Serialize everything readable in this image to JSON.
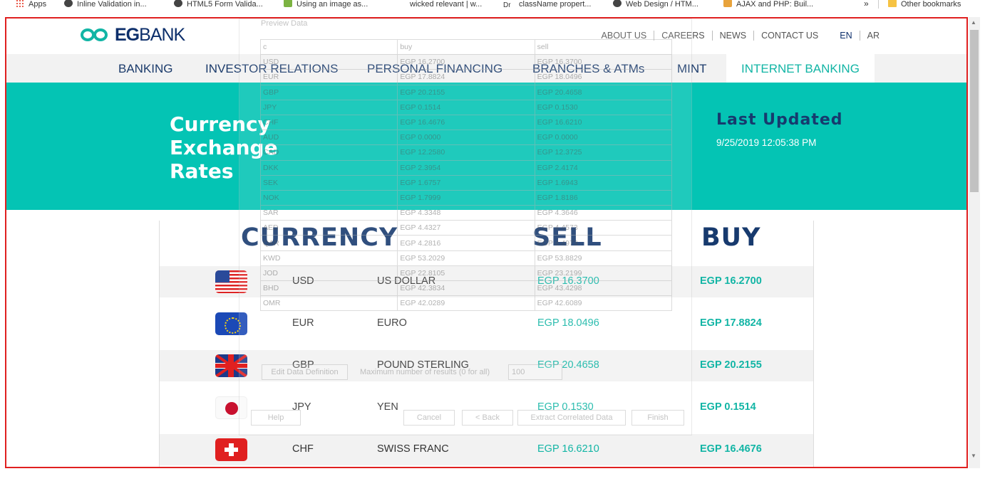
{
  "bookmarks": [
    {
      "label": "Apps",
      "icon": "apps-grid-icon"
    },
    {
      "label": "Inline Validation in...",
      "icon": "site-icon"
    },
    {
      "label": "HTML5 Form Valida...",
      "icon": "linux-icon"
    },
    {
      "label": "Using an image as...",
      "icon": "site-icon"
    },
    {
      "label": "wicked relevant | w...",
      "icon": "site-icon"
    },
    {
      "label": "className propert...",
      "icon": "dr-icon"
    },
    {
      "label": "Web Design / HTM...",
      "icon": "globe-icon"
    },
    {
      "label": "AJAX and PHP: Buil...",
      "icon": "book-icon"
    }
  ],
  "bookmarks_more": "»",
  "bookmarks_other": "Other bookmarks",
  "header": {
    "logo_text_bold": "EG",
    "logo_text": "BANK",
    "top_links": [
      "ABOUT US",
      "CAREERS",
      "NEWS",
      "CONTACT US"
    ],
    "lang": [
      "EN",
      "AR"
    ]
  },
  "nav": [
    "BANKING",
    "INVESTOR RELATIONS",
    "PERSONAL FINANCING",
    "BRANCHES & ATMs",
    "MINT",
    "INTERNET BANKING"
  ],
  "banner": {
    "title": "Currency\nExchange\nRates",
    "updated_label": "Last Updated",
    "updated_value": "9/25/2019 12:05:38 PM"
  },
  "rates": {
    "headers": {
      "currency": "CURRENCY",
      "sell": "SELL",
      "buy": "BUY"
    },
    "rows": [
      {
        "code": "USD",
        "name": "US DOLLAR",
        "sell": "EGP 16.3700",
        "buy": "EGP 16.2700",
        "flag": "us-flag-icon"
      },
      {
        "code": "EUR",
        "name": "EURO",
        "sell": "EGP 18.0496",
        "buy": "EGP 17.8824",
        "flag": "eu-flag-icon"
      },
      {
        "code": "GBP",
        "name": "POUND STERLING",
        "sell": "EGP 20.4658",
        "buy": "EGP 20.2155",
        "flag": "uk-flag-icon"
      },
      {
        "code": "JPY",
        "name": "YEN",
        "sell": "EGP 0.1530",
        "buy": "EGP 0.1514",
        "flag": "japan-flag-icon"
      },
      {
        "code": "CHF",
        "name": "SWISS FRANC",
        "sell": "EGP 16.6210",
        "buy": "EGP 16.4676",
        "flag": "swiss-flag-icon"
      }
    ]
  },
  "overlay": {
    "title": "Preview Data",
    "columns": [
      "c",
      "buy",
      "sell"
    ],
    "rows": [
      [
        "USD",
        "EGP 16.2700",
        "EGP 16.3700"
      ],
      [
        "EUR",
        "EGP 17.8824",
        "EGP 18.0496"
      ],
      [
        "GBP",
        "EGP 20.2155",
        "EGP 20.4658"
      ],
      [
        "JPY",
        "EGP 0.1514",
        "EGP 0.1530"
      ],
      [
        "CHF",
        "EGP 16.4676",
        "EGP 16.6210"
      ],
      [
        "AUD",
        "EGP 0.0000",
        "EGP 0.0000"
      ],
      [
        "CAD",
        "EGP 12.2580",
        "EGP 12.3725"
      ],
      [
        "DKK",
        "EGP 2.3954",
        "EGP 2.4174"
      ],
      [
        "SEK",
        "EGP 1.6757",
        "EGP 1.6943"
      ],
      [
        "NOK",
        "EGP 1.7999",
        "EGP 1.8186"
      ],
      [
        "SAR",
        "EGP 4.3348",
        "EGP 4.3646"
      ],
      [
        "AED",
        "EGP 4.4327",
        "EGP 4.4573"
      ],
      [
        "QAR",
        "EGP 4.2816",
        "EGP 4.4973"
      ],
      [
        "KWD",
        "EGP 53.2029",
        "EGP 53.8829"
      ],
      [
        "JOD",
        "EGP 22.8105",
        "EGP 23.2199"
      ],
      [
        "BHD",
        "EGP 42.3834",
        "EGP 43.4298"
      ],
      [
        "OMR",
        "EGP 42.0289",
        "EGP 42.6089"
      ]
    ],
    "edit_button": "Edit Data Definition",
    "max_label": "Maximum number of results (0 for all)",
    "max_value": "100",
    "help_button": "Help",
    "cancel_button": "Cancel",
    "back_button": "< Back",
    "extract_button": "Extract Correlated Data",
    "finish_button": "Finish"
  }
}
